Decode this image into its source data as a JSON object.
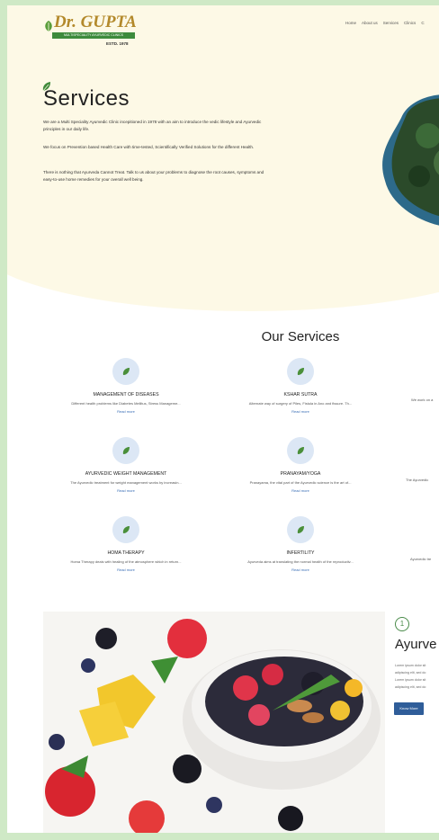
{
  "header": {
    "logo_name": "Dr. GUPTA",
    "logo_subtitle": "MULTISPECIALITY AYURVEDIC CLINICS",
    "logo_estd": "ESTD. 1978",
    "nav": [
      "Home",
      "About us",
      "Services",
      "Clinics",
      "C"
    ]
  },
  "hero": {
    "title": "Services",
    "paragraphs": [
      "We are a Multi Speciality Ayurvedic Clinic incepitioned in 1978 with an aim to introduce the vedic lifestyle and Ayurvedic principles in our daily life.",
      "We focus on Prevention based Health Care with time-tested, Scientifically Verified Solutions for the different Health.",
      "There is nothing that Ayurveda Cannot Treat. Talk to us about your problems to diagnose the root causes, symptoms and easy-to-use home remedies for your overall well being."
    ]
  },
  "our_services": {
    "title": "Our Services",
    "cards": [
      {
        "title": "MANAGEMENT OF DISEASES",
        "desc": "Different health problems like Diabetes Mellitus, Stress Manageme...",
        "link": "Read more"
      },
      {
        "title": "KSHAR SUTRA",
        "desc": "Alternate way of surgery of Piles, Fistula in Ano and fissure. Th...",
        "link": "Read more"
      },
      {
        "title": "AYURVEDIC WEIGHT MANAGEMENT",
        "desc": "The Ayurvedic treatment for weight management works by increasin...",
        "link": "Read more"
      },
      {
        "title": "PRANAYAM/YOGA",
        "desc": "Pranayama, the vital part of the Ayurvedic science is the art of...",
        "link": "Read more"
      },
      {
        "title": "HOMA THERAPY",
        "desc": "Homa Therapy deals with healing of the atmosphere which in return...",
        "link": "Read more"
      },
      {
        "title": "INFERTILITY",
        "desc": "Ayurveda aims at translating the normal health of the reproductiv...",
        "link": "Read more"
      }
    ],
    "partial_right": [
      "We work on a",
      "The Ayurvedic",
      "Ayurvedic tre"
    ]
  },
  "feature": {
    "number": "1",
    "title": "Ayurve",
    "text_lines": [
      "Lorem ipsum dolor sit",
      "adipiscing elit, sed do",
      "Lorem ipsum dolor sit",
      "adipiscing elit, sed do"
    ],
    "button": "Know More"
  },
  "colors": {
    "accent_green": "#3d8b3d",
    "logo_gold": "#b3892b",
    "button_blue": "#2f5d99",
    "hero_bg": "#fdf9e6"
  }
}
